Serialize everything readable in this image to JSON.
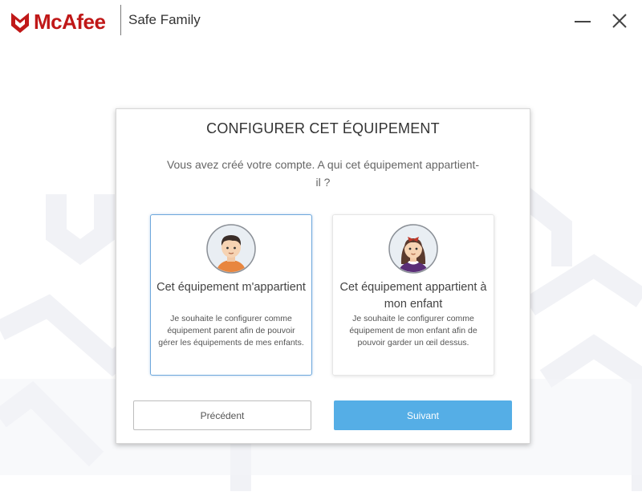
{
  "window": {
    "brand": "McAfee",
    "product": "Safe Family"
  },
  "dialog": {
    "title": "CONFIGURER CET ÉQUIPEMENT",
    "subtitle": "Vous avez créé votre compte. A qui cet équipement appartient-il ?",
    "options": [
      {
        "title": "Cet équipement m'appartient",
        "description": "Je souhaite le configurer comme équipement parent afin de pouvoir gérer les équipements de mes enfants.",
        "avatar_icon": "boy-avatar-icon",
        "selected": true
      },
      {
        "title": "Cet équipement appartient à mon enfant",
        "description": "Je souhaite le configurer comme équipement de mon enfant afin de pouvoir garder un œil dessus.",
        "avatar_icon": "girl-avatar-icon",
        "selected": false
      }
    ],
    "buttons": {
      "back_label": "Précédent",
      "next_label": "Suivant"
    }
  },
  "colors": {
    "brand_red": "#c01818",
    "primary_button": "#55aee6",
    "selected_border": "#6ea8dc"
  }
}
